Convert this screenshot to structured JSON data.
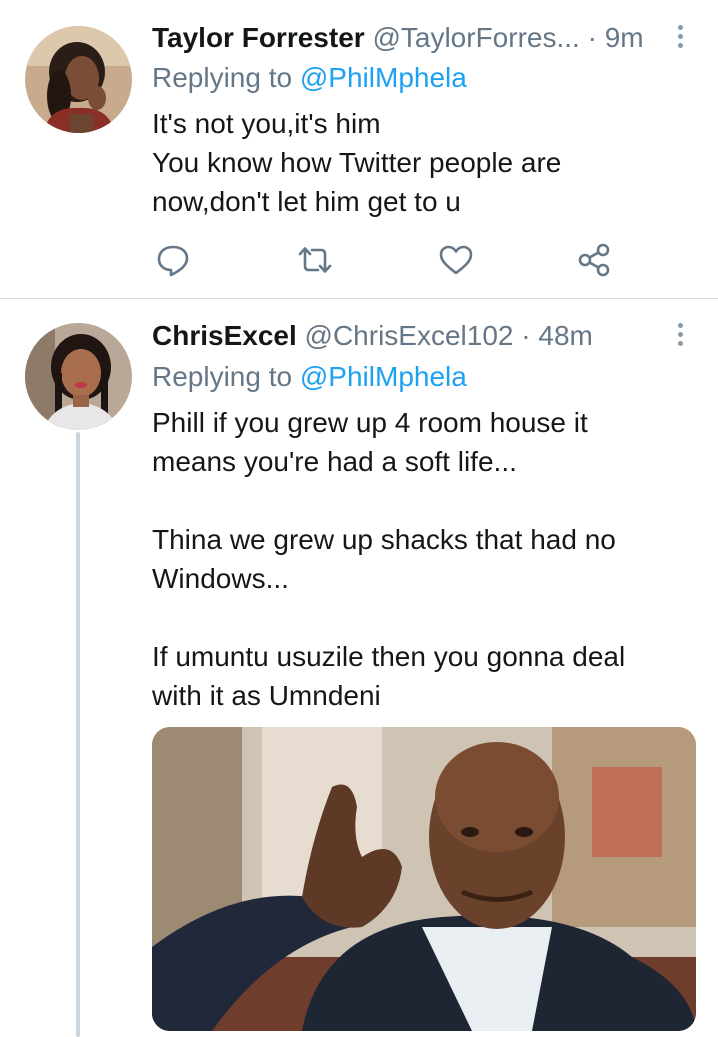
{
  "tweets": [
    {
      "name": "Taylor Forrester",
      "handle": "@TaylorForres...",
      "separator": "·",
      "time": "9m",
      "replying_label": "Replying to",
      "replying_handle": "@PhilMphela",
      "lines": [
        "It's not you,it's him",
        "You know how Twitter people are",
        "now,don't let him get to u"
      ],
      "icons": {
        "reply": "reply-icon",
        "retweet": "retweet-icon",
        "like": "heart-icon",
        "share": "share-icon",
        "more": "more-vertical-icon"
      }
    },
    {
      "name": "ChrisExcel",
      "handle": "@ChrisExcel102",
      "separator": "·",
      "time": "48m",
      "replying_label": "Replying to",
      "replying_handle": "@PhilMphela",
      "paragraphs": [
        [
          "Phill if you grew up 4 room house it",
          "means you're had a soft life..."
        ],
        [
          "Thina we grew up shacks that had no",
          "Windows..."
        ],
        [
          "If umuntu usuzile then you gonna deal",
          "with it as Umndeni"
        ]
      ],
      "icons": {
        "more": "more-vertical-icon"
      }
    }
  ],
  "colors": {
    "text": "#14171a",
    "secondary": "#657786",
    "link": "#1da1f2",
    "divider": "#d9dde0",
    "thread_line": "#cdd5dc",
    "icon": "#657786"
  }
}
